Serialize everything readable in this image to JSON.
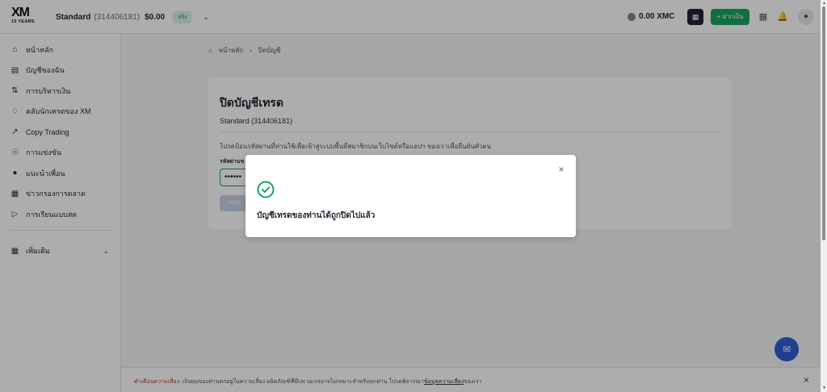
{
  "header": {
    "logo_text": "XM",
    "logo_sub": "15 YEARS",
    "account_type": "Standard",
    "account_number": "(314406181)",
    "balance": "$0.00",
    "account_badge": "จริง",
    "xmc_balance": "0.00 XMC",
    "deposit_label": "+ ฝากเงิน"
  },
  "sidebar": {
    "items": [
      {
        "label": "หน้าหลัก",
        "icon": "home-icon"
      },
      {
        "label": "บัญชีของฉัน",
        "icon": "wallet-icon"
      },
      {
        "label": "การบริหารเงิน",
        "icon": "transfer-icon"
      },
      {
        "label": "คลับนักเทรดของ XM",
        "icon": "diamond-icon"
      },
      {
        "label": "Copy Trading",
        "icon": "trend-icon"
      },
      {
        "label": "การแข่งขัน",
        "icon": "trophy-icon"
      },
      {
        "label": "แนะนำเพื่อน",
        "icon": "users-icon"
      },
      {
        "label": "ข่าวกรองการตลาด",
        "icon": "news-icon"
      },
      {
        "label": "การเรียนแบบสด",
        "icon": "video-icon"
      }
    ],
    "more_label": "เพิ่มเติม"
  },
  "breadcrumb": {
    "home": "หน้าหลัก",
    "current": "ปิดบัญชี"
  },
  "card": {
    "title": "ปิดบัญชีเทรด",
    "subtitle": "Standard (314406181)",
    "instruction": "โปรดป้อนรหัสผ่านที่ท่านใช้เพื่อเข้าสู่ระบบพื้นที่สมาชิกบนเว็บไซต์หรือแอปฯ ของเราเพื่อยืนยันตัวตน",
    "password_label": "รหัสผ่านข",
    "password_value": "••••••",
    "submit_label": "ปิดบัญ"
  },
  "modal": {
    "message": "บัญชีเทรดของท่านได้ถูกปิดไปแล้ว",
    "close_label": "×"
  },
  "footer": {
    "warning_label": "คำเตือนความเสี่ยง:",
    "text": " เงินทุนของท่านตกอยู่ในความเสี่ยง ผลิตภัณฑ์ที่มีเลเวอเรจอาจไม่เหมาะสำหรับทุกท่าน โปรดพิจารณา",
    "link_text": "ข้อมูลความเสี่ยง",
    "text_after": "ของเรา"
  },
  "colors": {
    "accent_green": "#1aa260",
    "chat_blue": "#2d5fd3",
    "warning_red": "#b23b3b"
  }
}
